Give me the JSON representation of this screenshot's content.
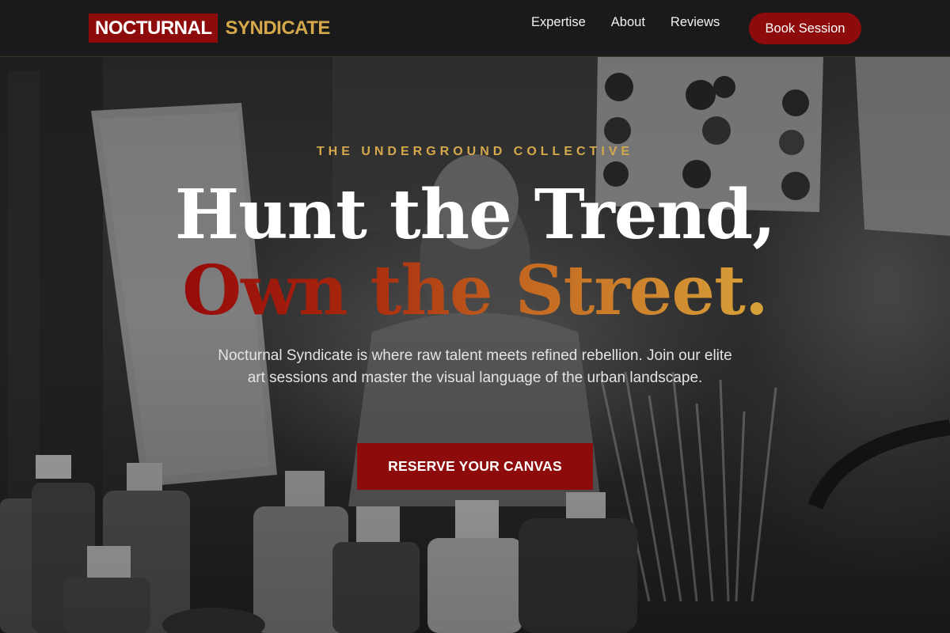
{
  "brand": {
    "word_1": "NOCTURNAL",
    "word_2": "SYNDICATE"
  },
  "nav": {
    "links": [
      {
        "label": "Expertise"
      },
      {
        "label": "About"
      },
      {
        "label": "Reviews"
      }
    ],
    "cta_label": "Book Session"
  },
  "hero": {
    "eyebrow": "THE UNDERGROUND COLLECTIVE",
    "headline_line_1": "Hunt the Trend,",
    "headline_line_2": "Own the Street.",
    "description": "Nocturnal Syndicate is where raw talent meets refined rebellion. Join our elite art sessions and master the visual language of the urban landscape.",
    "cta_label": "RESERVE YOUR CANVAS"
  },
  "colors": {
    "accent_red": "#8e0b0b",
    "accent_gold": "#d4a84b",
    "navbar_bg": "#1a1a1a"
  }
}
